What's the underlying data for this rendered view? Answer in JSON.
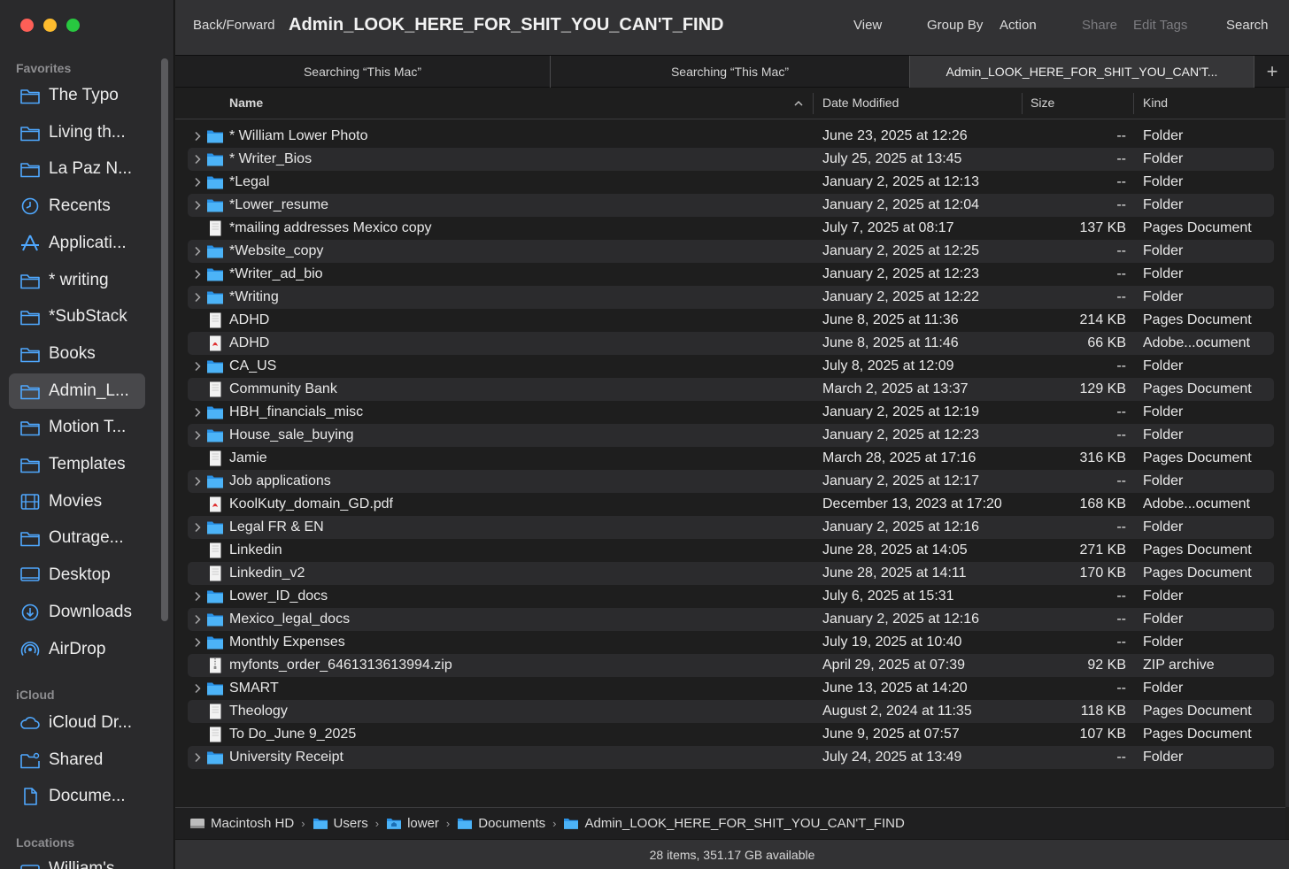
{
  "window": {
    "title": "Admin_LOOK_HERE_FOR_SHIT_YOU_CAN'T_FIND"
  },
  "toolbar": {
    "back_forward": "Back/Forward",
    "view": "View",
    "group_by": "Group By",
    "action": "Action",
    "share": "Share",
    "edit_tags": "Edit Tags",
    "search": "Search"
  },
  "tabs": [
    {
      "label": "Searching “This Mac”"
    },
    {
      "label": "Searching “This Mac”"
    },
    {
      "label": "Admin_LOOK_HERE_FOR_SHIT_YOU_CAN'T..."
    }
  ],
  "sidebar": {
    "favorites_header": "Favorites",
    "icloud_header": "iCloud",
    "locations_header": "Locations",
    "favorites": [
      {
        "label": "The Typo",
        "icon": "folder-icon"
      },
      {
        "label": "Living th...",
        "icon": "folder-icon"
      },
      {
        "label": "La Paz N...",
        "icon": "folder-icon"
      },
      {
        "label": "Recents",
        "icon": "clock-icon"
      },
      {
        "label": "Applicati...",
        "icon": "applications-icon"
      },
      {
        "label": "* writing",
        "icon": "folder-icon"
      },
      {
        "label": "*SubStack",
        "icon": "folder-icon"
      },
      {
        "label": "Books",
        "icon": "folder-icon"
      },
      {
        "label": "Admin_L...",
        "icon": "folder-icon"
      },
      {
        "label": "Motion T...",
        "icon": "folder-icon"
      },
      {
        "label": "Templates",
        "icon": "folder-icon"
      },
      {
        "label": "Movies",
        "icon": "film-icon"
      },
      {
        "label": "Outrage...",
        "icon": "folder-icon"
      },
      {
        "label": "Desktop",
        "icon": "desktop-icon"
      },
      {
        "label": "Downloads",
        "icon": "download-icon"
      },
      {
        "label": "AirDrop",
        "icon": "airdrop-icon"
      }
    ],
    "icloud": [
      {
        "label": "iCloud Dr...",
        "icon": "cloud-icon"
      },
      {
        "label": "Shared",
        "icon": "shared-folder-icon"
      },
      {
        "label": "Docume...",
        "icon": "document-icon"
      }
    ],
    "locations": [
      {
        "label": "William's",
        "icon": "drive-icon"
      }
    ]
  },
  "columns": {
    "name": "Name",
    "date": "Date Modified",
    "size": "Size",
    "kind": "Kind"
  },
  "files": [
    {
      "name": "* William Lower Photo",
      "date": "June 23, 2025 at 12:26",
      "size": "--",
      "kind": "Folder",
      "type": "folder"
    },
    {
      "name": "* Writer_Bios",
      "date": "July 25, 2025 at 13:45",
      "size": "--",
      "kind": "Folder",
      "type": "folder"
    },
    {
      "name": "*Legal",
      "date": "January 2, 2025 at 12:13",
      "size": "--",
      "kind": "Folder",
      "type": "folder"
    },
    {
      "name": "*Lower_resume",
      "date": "January 2, 2025 at 12:04",
      "size": "--",
      "kind": "Folder",
      "type": "folder"
    },
    {
      "name": "*mailing addresses Mexico copy",
      "date": "July 7, 2025 at 08:17",
      "size": "137 KB",
      "kind": "Pages Document",
      "type": "doc"
    },
    {
      "name": "*Website_copy",
      "date": "January 2, 2025 at 12:25",
      "size": "--",
      "kind": "Folder",
      "type": "folder"
    },
    {
      "name": "*Writer_ad_bio",
      "date": "January 2, 2025 at 12:23",
      "size": "--",
      "kind": "Folder",
      "type": "folder"
    },
    {
      "name": "*Writing",
      "date": "January 2, 2025 at 12:22",
      "size": "--",
      "kind": "Folder",
      "type": "folder"
    },
    {
      "name": "ADHD",
      "date": "June 8, 2025 at 11:36",
      "size": "214 KB",
      "kind": "Pages Document",
      "type": "doc"
    },
    {
      "name": "ADHD",
      "date": "June 8, 2025 at 11:46",
      "size": "66 KB",
      "kind": "Adobe...ocument",
      "type": "pdf"
    },
    {
      "name": "CA_US",
      "date": "July 8, 2025 at 12:09",
      "size": "--",
      "kind": "Folder",
      "type": "folder"
    },
    {
      "name": "Community Bank",
      "date": "March 2, 2025 at 13:37",
      "size": "129 KB",
      "kind": "Pages Document",
      "type": "doc"
    },
    {
      "name": "HBH_financials_misc",
      "date": "January 2, 2025 at 12:19",
      "size": "--",
      "kind": "Folder",
      "type": "folder"
    },
    {
      "name": "House_sale_buying",
      "date": "January 2, 2025 at 12:23",
      "size": "--",
      "kind": "Folder",
      "type": "folder"
    },
    {
      "name": "Jamie",
      "date": "March 28, 2025 at 17:16",
      "size": "316 KB",
      "kind": "Pages Document",
      "type": "doc"
    },
    {
      "name": "Job applications",
      "date": "January 2, 2025 at 12:17",
      "size": "--",
      "kind": "Folder",
      "type": "folder"
    },
    {
      "name": "KoolKuty_domain_GD.pdf",
      "date": "December 13, 2023 at 17:20",
      "size": "168 KB",
      "kind": "Adobe...ocument",
      "type": "pdf"
    },
    {
      "name": "Legal FR & EN",
      "date": "January 2, 2025 at 12:16",
      "size": "--",
      "kind": "Folder",
      "type": "folder"
    },
    {
      "name": "Linkedin",
      "date": "June 28, 2025 at 14:05",
      "size": "271 KB",
      "kind": "Pages Document",
      "type": "doc"
    },
    {
      "name": "Linkedin_v2",
      "date": "June 28, 2025 at 14:11",
      "size": "170 KB",
      "kind": "Pages Document",
      "type": "doc"
    },
    {
      "name": "Lower_ID_docs",
      "date": "July 6, 2025 at 15:31",
      "size": "--",
      "kind": "Folder",
      "type": "folder"
    },
    {
      "name": "Mexico_legal_docs",
      "date": "January 2, 2025 at 12:16",
      "size": "--",
      "kind": "Folder",
      "type": "folder"
    },
    {
      "name": "Monthly Expenses",
      "date": "July 19, 2025 at 10:40",
      "size": "--",
      "kind": "Folder",
      "type": "folder"
    },
    {
      "name": "myfonts_order_6461313613994.zip",
      "date": "April 29, 2025 at 07:39",
      "size": "92 KB",
      "kind": "ZIP archive",
      "type": "zip"
    },
    {
      "name": "SMART",
      "date": "June 13, 2025 at 14:20",
      "size": "--",
      "kind": "Folder",
      "type": "folder"
    },
    {
      "name": "Theology",
      "date": "August 2, 2024 at 11:35",
      "size": "118 KB",
      "kind": "Pages Document",
      "type": "doc"
    },
    {
      "name": "To Do_June 9_2025",
      "date": "June 9, 2025 at 07:57",
      "size": "107 KB",
      "kind": "Pages Document",
      "type": "doc"
    },
    {
      "name": "University Receipt",
      "date": "July 24, 2025 at 13:49",
      "size": "--",
      "kind": "Folder",
      "type": "folder"
    }
  ],
  "pathbar": [
    {
      "label": "Macintosh HD",
      "icon": "drive-icon"
    },
    {
      "label": "Users",
      "icon": "folder-icon"
    },
    {
      "label": "lower",
      "icon": "home-folder-icon"
    },
    {
      "label": "Documents",
      "icon": "folder-icon"
    },
    {
      "label": "Admin_LOOK_HERE_FOR_SHIT_YOU_CAN'T_FIND",
      "icon": "folder-icon"
    }
  ],
  "status": "28 items, 351.17 GB available",
  "colors": {
    "folder_blue": "#3fa9f5",
    "pdf_red": "#e02e2e",
    "selection": "#48484b"
  }
}
